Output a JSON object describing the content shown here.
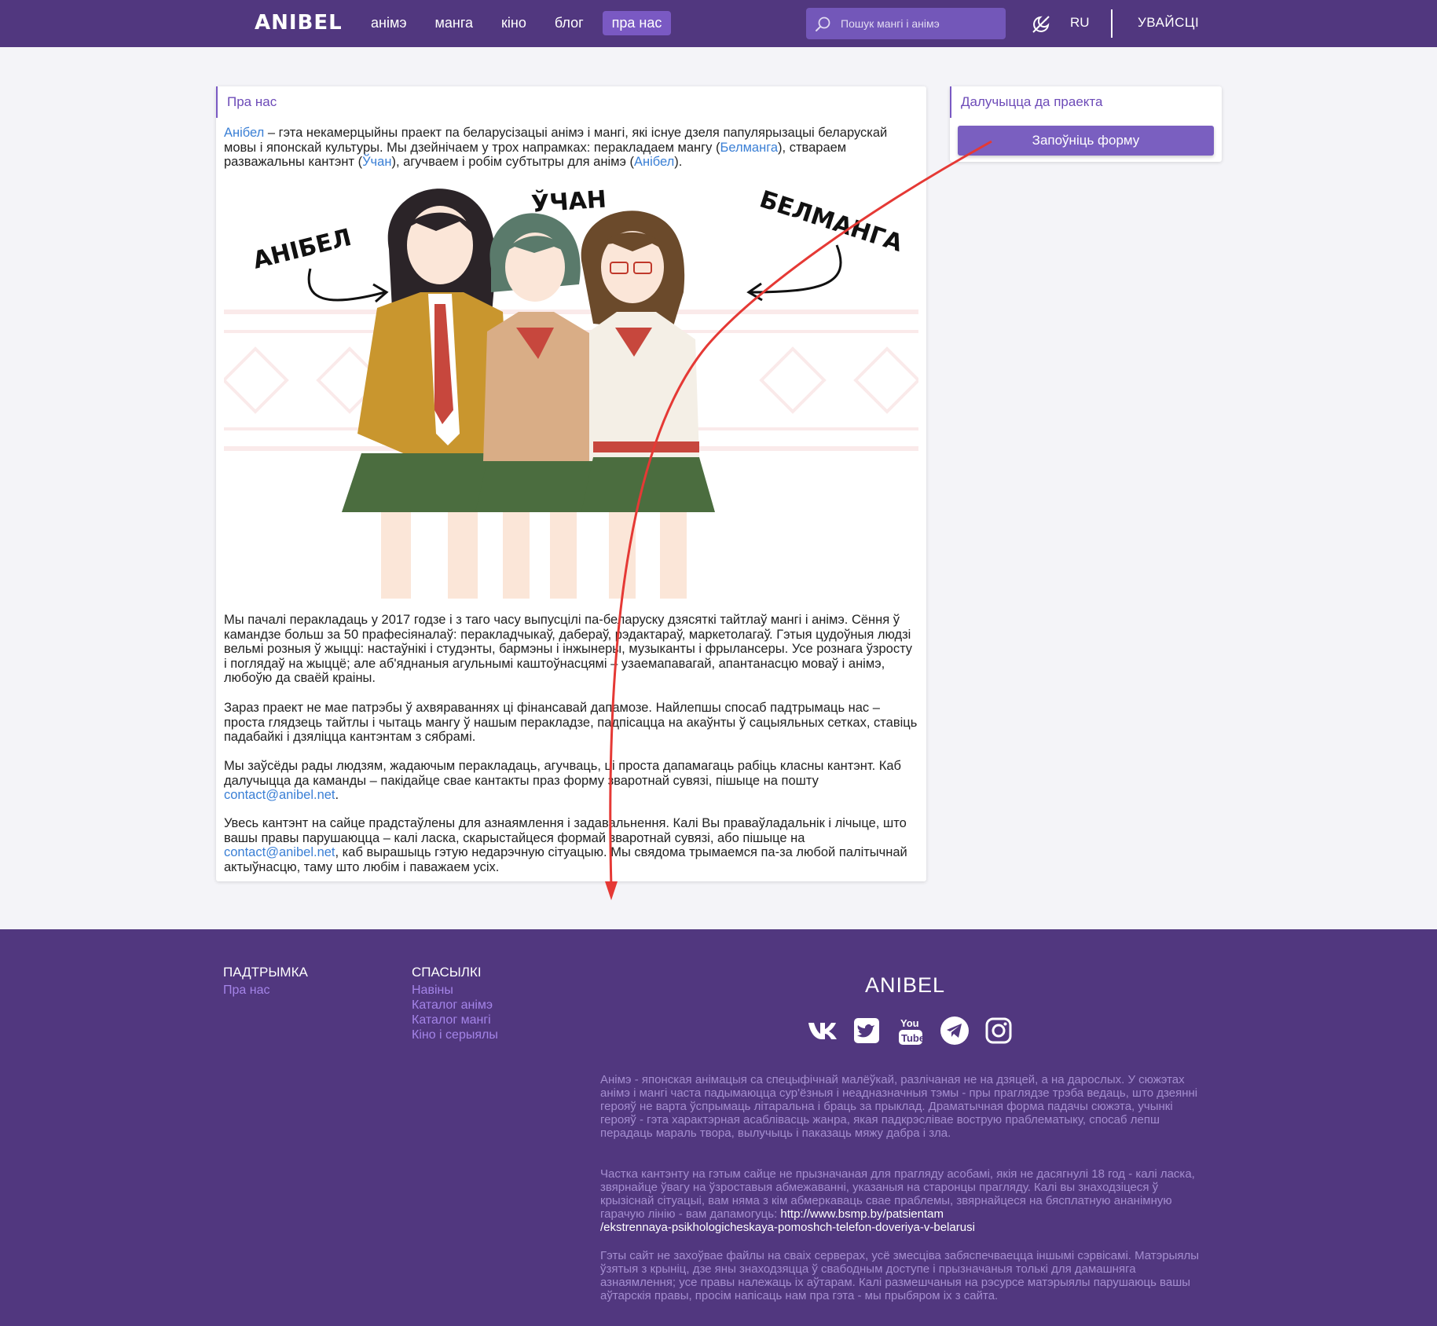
{
  "header": {
    "logo": "ANIBEL",
    "nav": [
      "анімэ",
      "манга",
      "кіно",
      "блог",
      "пра нас"
    ],
    "active_nav": "пра нас",
    "search_placeholder": "Пошук мангі і анімэ",
    "lang": "RU",
    "login": "УВАЙСЦІ"
  },
  "about": {
    "title": "Пра нас",
    "intro": {
      "link1": "Анібел",
      "text1": " – гэта некамерцыйны праект па беларусізацыі анімэ і мангі, які існуе дзеля папулярызацыі беларускай мовы і японскай культуры. Мы дзейнічаем у трох напрамках: перакладаем мангу (",
      "link2": "Белманга",
      "text2": "), ствараем разважальны кантэнт (",
      "link3": "Ўчан",
      "text3": "), агучваем і робім субтытры для анімэ (",
      "link4": "Анібел",
      "text4": ")."
    },
    "illustration_labels": [
      "АНІБЕЛ",
      "ЎЧАН",
      "БЕЛМАНГА"
    ],
    "p2": "Мы пачалі перакладаць у 2017 годзе і з таго часу выпусцілі па-беларуску дзясяткі тайтлаў мангі і анімэ. Сёння ў камандзе больш за 50 прафесіяналаў: перакладчыкаў, дабераў, рэдактараў, маркетолагаў. Гэтыя цудоўныя людзі вельмі розныя ў жыцці: настаўнікі і студэнты, бармэны і інжынеры, музыканты і фрылансеры. Усе рознага ўзросту і поглядаў на жыццё; але аб'яднаныя агульнымі каштоўнасцямі – узаемапавагай, апантанасцю моваў і анімэ, любоўю да сваёй краіны.",
    "p3": "Зараз праект не мае патрэбы ў ахвяраваннях ці фінансавай дапамозе. Найлепшы спосаб падтрымаць нас – проста глядзець тайтлы і чытаць мангу ў нашым перакладзе, падпісацца на акаўнты ў сацыяльных сетках, ставіць падабайкі і дзяліцца кантэнтам з сябрамі.",
    "p4": {
      "text1": "Мы заўсёды рады людзям, жадаючым перакладаць, агучваць, ці проста дапамагаць рабіць класны кантэнт. Каб далучыцца да каманды – пакідайце свае кантакты праз форму зваротнай сувязі, пішыце на пошту ",
      "email": "contact@anibel.net",
      "text2": "."
    },
    "p5": {
      "text1": "Увесь кантэнт на сайце прадстаўлены для азнаямлення і задавальнення. Калі Вы праваўладальнік і лічыце, што вашы правы парушаюцца – калі ласка, скарыстайцеся формай зваротнай сувязі, або пішыце на ",
      "email": "contact@anibel.net",
      "text2": ", каб вырашыць гэтую недарэчную сітуацыю. Мы свядома трымаемся па-за любой палітычнай актыўнасцю, таму што любім і паважаем усіх."
    }
  },
  "join": {
    "title": "Далучыцца да праекта",
    "button": "Запоўніць форму"
  },
  "footer": {
    "support_heading": "ПАДТРЫМКА",
    "support_links": [
      "Пра нас"
    ],
    "links_heading": "СПАСЫЛКІ",
    "links": [
      "Навіны",
      "Каталог анімэ",
      "Каталог мангі",
      "Кіно і серыялы"
    ],
    "brand": "ANIBEL",
    "socials": [
      "vk-icon",
      "twitter-icon",
      "youtube-icon",
      "telegram-icon",
      "instagram-icon"
    ],
    "text1": "Анімэ - японская анімацыя са спецыфічнай малёўкай, разлічаная не на дзяцей, а на дарослых. У сюжэтах анімэ і мангі часта падымаюцца сур'ёзныя і неадназначныя тэмы - пры праглядзе трэба ведаць, што дзеянні герояў не варта ўспрымаць літаральна і браць за прыклад. Драматычная форма падачы сюжэта, учынкі герояў - гэта характэрная асаблівасць жанра, якая падкрэслівае вострую праблематыку, спосаб лепш перадаць мараль твора, вылучыць і паказаць мяжу дабра і зла.",
    "text2": "Частка кантэнту на гэтым сайце не прызначаная для прагляду асобамі, якія не дасягнулі 18 год - калі ласка, звярнайце ўвагу на ўзроставыя абмежаванні, указаныя на старонцы прагляду. Калі вы знаходзіцеся ў крызіснай сітуацыі, вам няма з кім абмеркаваць свае праблемы, звярнайцеся на бясплатную ананімную гарачую лінію - вам дапамогуць: ",
    "text2_link_line1": "http://www.bsmp.by/patsientam",
    "text2_link_line2": "/ekstrennaya-psikhologicheskaya-pomoshch-telefon-doveriya-v-belarusi",
    "text3": "Гэты сайт не захоўвае файлы на сваіх серверах, усё змесціва забяспечваецца іншымі сэрвісамі. Матэрыялы ўзятыя з крыніц, дзе яны знаходзяцца ў свабодным доступе і прызначаныя толькі для дамашняга азнаямлення; усе правы належаць іх аўтарам. Калі размешчаныя на рэсурсе матэрыялы парушаюць вашы аўтарскія правы, просім напісаць нам пра гэта - мы прыбяром іх з сайта."
  },
  "colors": {
    "header_bg": "#51377f",
    "accent": "#7a59c3",
    "link": "#3a7fd5",
    "footer_link": "#a484e8",
    "annotation_arrow": "#e53935"
  }
}
